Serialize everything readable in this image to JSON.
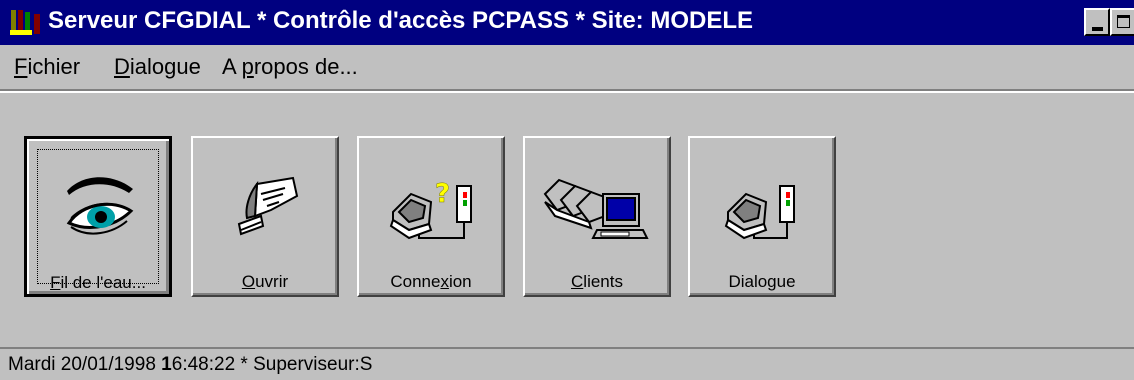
{
  "window": {
    "title": "Serveur CFGDIAL * Contrôle d'accès PCPASS * Site: MODELE"
  },
  "menu": {
    "fichier": {
      "accel": "F",
      "rest": "ichier"
    },
    "dialogue": {
      "accel": "D",
      "rest": "ialogue"
    },
    "apropos": {
      "pre": "A ",
      "accel": "p",
      "rest": "ropos de..."
    }
  },
  "toolbar": {
    "buttons": [
      {
        "pre": "",
        "accel": "F",
        "rest": "il de l'eau...",
        "icon": "eye-icon"
      },
      {
        "pre": "",
        "accel": "O",
        "rest": "uvrir",
        "icon": "hand-card-icon"
      },
      {
        "pre": "Conne",
        "accel": "x",
        "rest": "ion",
        "icon": "terminal-query-icon"
      },
      {
        "pre": "",
        "accel": "C",
        "rest": "lients",
        "icon": "clients-network-icon"
      },
      {
        "pre": "",
        "accel": "",
        "rest": "Dialogue",
        "icon": "terminal-signal-icon"
      }
    ]
  },
  "status": {
    "date": "Mardi 20/01/1998 ",
    "time_bold": "1",
    "time_rest": "6:48:22",
    "suffix": " * Superviseur:S"
  },
  "colors": {
    "title_bg": "#000080",
    "face": "#c0c0c0",
    "eye_iris": "#00a0a8",
    "monitor_screen": "#0000a8",
    "query_mark": "#ffff00",
    "signal_red": "#ff0000",
    "signal_green": "#00a000"
  }
}
